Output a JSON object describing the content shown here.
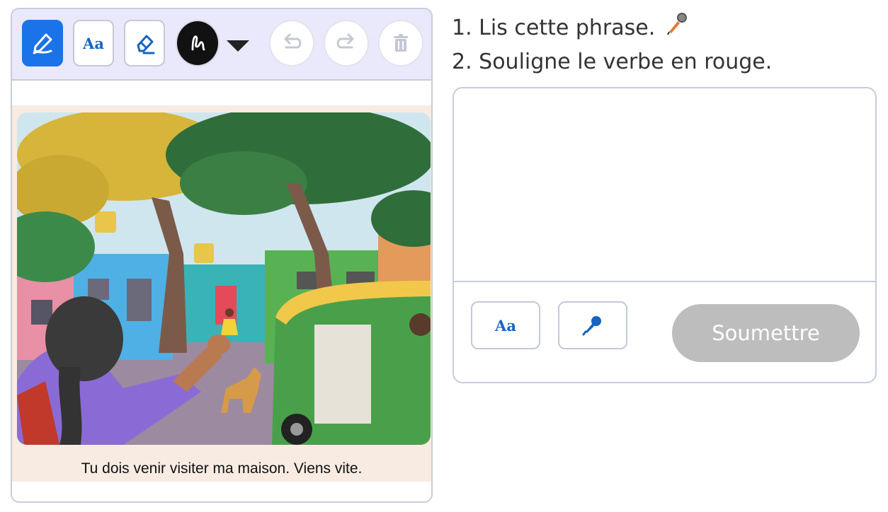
{
  "toolbar": {
    "pen_icon": "pen-icon",
    "text_label": "Aa",
    "eraser_icon": "eraser-icon",
    "color_value": "#111111",
    "undo_icon": "undo-icon",
    "redo_icon": "redo-icon",
    "delete_icon": "trash-icon"
  },
  "picture": {
    "caption": "Tu dois venir visiter ma maison. Viens vite."
  },
  "instructions": {
    "line1": "1. Lis cette phrase.",
    "line2": "2. Souligne le verbe en rouge."
  },
  "answer": {
    "value": "",
    "text_label": "Aa",
    "mic_icon": "microphone-icon",
    "submit_label": "Soumettre"
  },
  "colors": {
    "accent": "#1a73e8",
    "disabled": "#bdbdbd",
    "toolbar_bg": "#e9e9fb"
  }
}
